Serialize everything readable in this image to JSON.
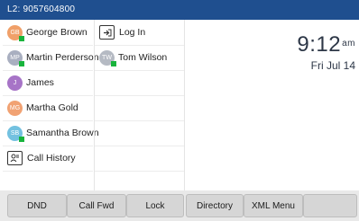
{
  "status_bar": {
    "line_label": "L2: 9057604800"
  },
  "contacts_col1": [
    {
      "name": "George Brown",
      "initials": "GB",
      "color": "#f0a069",
      "presence": true
    },
    {
      "name": "Martin Perderson",
      "initials": "MP",
      "color": "#a9afc0",
      "presence": true
    },
    {
      "name": "James",
      "initials": "J",
      "color": "#a774c7",
      "presence": false
    },
    {
      "name": "Martha Gold",
      "initials": "MG",
      "color": "#f1a273",
      "presence": false
    },
    {
      "name": "Samantha Brown",
      "initials": "SB",
      "color": "#73c1e0",
      "presence": true
    },
    {
      "name": "Call History",
      "icon": "call-history-icon"
    }
  ],
  "contacts_col2": [
    {
      "name": "Log In",
      "icon": "login-icon"
    },
    {
      "name": "Tom Wilson",
      "initials": "TW",
      "color": "#b5bac3",
      "presence": true
    }
  ],
  "clock": {
    "time": "9:12",
    "ampm": "am",
    "date": "Fri Jul 14"
  },
  "softkeys": [
    "DND",
    "Call Fwd",
    "Lock",
    "Directory",
    "XML Menu",
    ""
  ],
  "colors": {
    "header": "#1f4f8f",
    "presence": "#18b43c",
    "softkey_bg": "#d6d6d6"
  }
}
